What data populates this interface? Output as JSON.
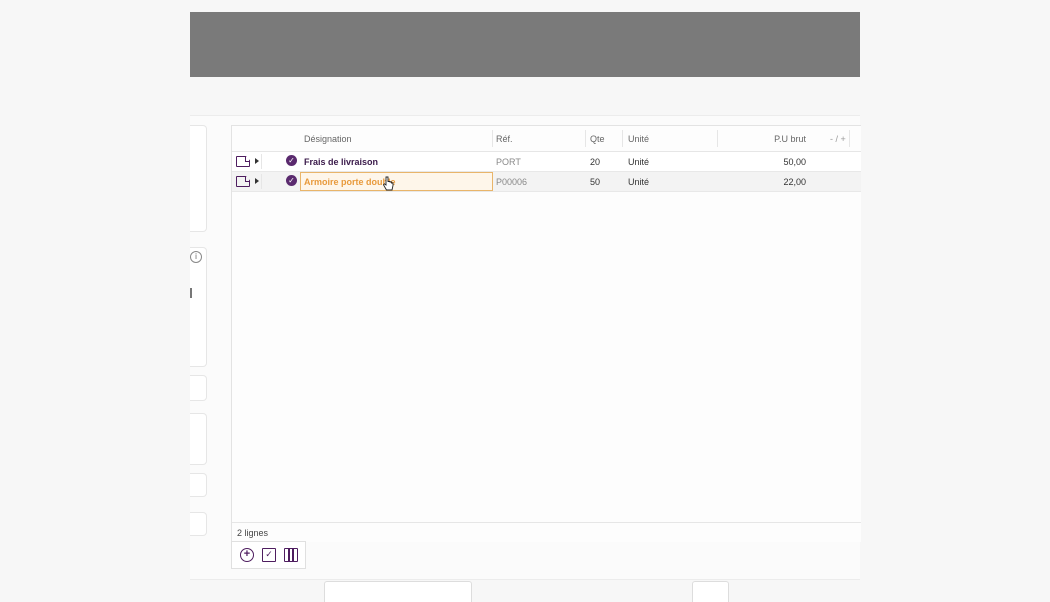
{
  "grid": {
    "columns": {
      "designation": "Désignation",
      "ref": "Réf.",
      "qte": "Qte",
      "unite": "Unité",
      "pu_brut": "P.U brut",
      "extra": "- / +"
    },
    "rows": [
      {
        "designation": "Frais de livraison",
        "ref": "PORT",
        "qte": "20",
        "unite": "Unité",
        "pu_brut": "50,00"
      },
      {
        "designation": "Armoire porte double",
        "ref": "P00006",
        "qte": "50",
        "unite": "Unité",
        "pu_brut": "22,00"
      }
    ],
    "count_label": "2 lignes"
  },
  "side": {
    "info_glyph": "i"
  },
  "toolbar": {
    "add_icon": "plus-circle-icon",
    "check_icon": "checkbox-icon",
    "columns_icon": "columns-icon"
  },
  "colors": {
    "accent": "#4e1d5f",
    "editing_text": "#e89a3c",
    "editing_border": "#e9b56a"
  }
}
